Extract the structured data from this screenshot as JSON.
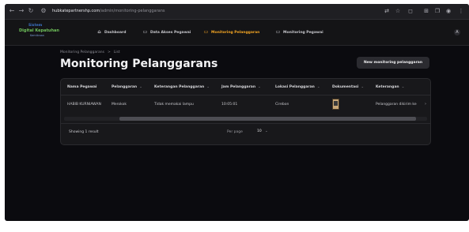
{
  "browser": {
    "url_host": "hubkatepartnershp.com",
    "url_path": "/admin/monitoring-pelanggarans",
    "icons": [
      "back-icon",
      "forward-icon",
      "reload-icon",
      "site-info-icon",
      "translate-icon",
      "star-icon",
      "extension-icon",
      "window-icon",
      "profile-icon",
      "menu-icon"
    ]
  },
  "app": {
    "logo": {
      "line1": "Sistem",
      "line2": "Digital Kepatuhan",
      "line3": "Kemitraan"
    },
    "nav": [
      {
        "label": "Dashboard",
        "icon": "home-icon",
        "active": false
      },
      {
        "label": "Data Akses Pegawai",
        "icon": "document-icon",
        "active": false
      },
      {
        "label": "Monitoring Pelanggaran",
        "icon": "document-icon",
        "active": true
      },
      {
        "label": "Monitoring Pegawai",
        "icon": "document-icon",
        "active": false
      }
    ],
    "avatar_initial": "A"
  },
  "page": {
    "breadcrumb": [
      "Monitoring Pelanggarans",
      "List"
    ],
    "breadcrumb_sep": ">",
    "title": "Monitoring Pelanggarans",
    "new_button": "New monitoring pelanggaran"
  },
  "table": {
    "columns": [
      {
        "label": "Nama Pegawai",
        "sortable": false
      },
      {
        "label": "Pelanggaran",
        "sortable": true
      },
      {
        "label": "Keterangan Pelanggaran",
        "sortable": true
      },
      {
        "label": "Jam Pelanggaran",
        "sortable": true
      },
      {
        "label": "Lokasi Pelanggaran",
        "sortable": true
      },
      {
        "label": "Dokumentasi",
        "sortable": true
      },
      {
        "label": "Keterangan",
        "sortable": true
      }
    ],
    "sort_glyph": "⌄",
    "rows": [
      {
        "nama": "HABIB KURNIAWAN",
        "pelanggaran": "Merokok",
        "keterangan_pelanggaran": "Tidak memakai lampu",
        "jam": "10:05:01",
        "lokasi": "Cirebon",
        "keterangan": "Pelanggaran dikirim ke"
      }
    ],
    "row_more_glyph": "›",
    "footer": {
      "showing": "Showing 1 result",
      "per_page_label": "Per page",
      "per_page_value": "10",
      "chevron": "⌄"
    }
  }
}
